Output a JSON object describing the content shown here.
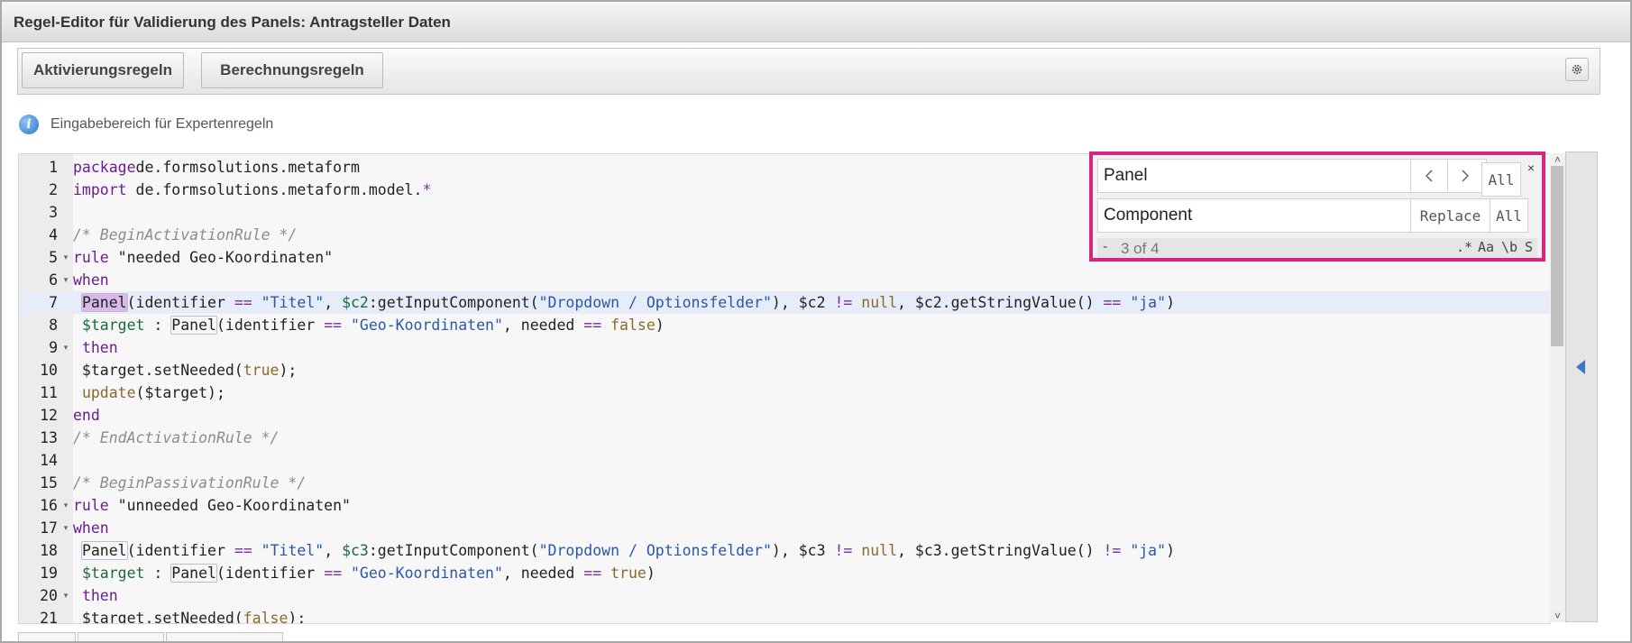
{
  "window": {
    "title": "Regel-Editor für Validierung des Panels: Antragsteller Daten"
  },
  "toolbar": {
    "activation_label": "Aktivierungsregeln",
    "calculation_label": "Berechnungsregeln",
    "settings_icon": "gear-icon"
  },
  "info": {
    "icon": "info-icon",
    "label": "Eingabebereich für Expertenregeln"
  },
  "search": {
    "find_value": "Panel",
    "replace_value": "Component",
    "prev_icon": "chevron-left-icon",
    "next_icon": "chevron-right-icon",
    "find_all_label": "All",
    "replace_label": "Replace",
    "replace_all_label": "All",
    "close_label": "×",
    "collapse_label": "-",
    "counter": "3 of 4",
    "regex_label": ".*",
    "case_label": "Aa",
    "word_label": "\\b",
    "selection_label": "S"
  },
  "editor": {
    "active_line": 7,
    "lines": [
      {
        "n": "1",
        "fold": "",
        "t": [
          [
            "kw",
            "package"
          ],
          [
            "",
            "de.formsolutions.metaform"
          ]
        ]
      },
      {
        "n": "2",
        "fold": "",
        "t": [
          [
            "kw",
            "import"
          ],
          [
            "",
            " de.formsolutions.metaform.model."
          ],
          [
            "op",
            "*"
          ]
        ]
      },
      {
        "n": "3",
        "fold": "",
        "t": []
      },
      {
        "n": "4",
        "fold": "",
        "t": [
          [
            "cm",
            "/* BeginActivationRule */"
          ]
        ]
      },
      {
        "n": "5",
        "fold": "▾",
        "t": [
          [
            "kw",
            "rule"
          ],
          [
            "",
            " \"needed Geo-Koordinaten\""
          ]
        ]
      },
      {
        "n": "6",
        "fold": "▾",
        "t": [
          [
            "kw",
            "when"
          ]
        ]
      },
      {
        "n": "7",
        "fold": "",
        "t": [
          [
            "",
            " "
          ],
          [
            "msel",
            "Panel"
          ],
          [
            "",
            "(identifier "
          ],
          [
            "op",
            "=="
          ],
          [
            "",
            " "
          ],
          [
            "st",
            "\"Titel\""
          ],
          [
            "",
            ", "
          ],
          [
            "vr",
            "$c2"
          ],
          [
            "",
            ":getInputComponent("
          ],
          [
            "st",
            "\"Dropdown / Optionsfelder\""
          ],
          [
            "",
            "), $c2 "
          ],
          [
            "op",
            "!="
          ],
          [
            "",
            " "
          ],
          [
            "lit",
            "null"
          ],
          [
            "",
            ", $c2.getStringValue() "
          ],
          [
            "op",
            "=="
          ],
          [
            "",
            " "
          ],
          [
            "st",
            "\"ja\""
          ],
          [
            "",
            ")"
          ]
        ]
      },
      {
        "n": "8",
        "fold": "",
        "t": [
          [
            "",
            " "
          ],
          [
            "vr",
            "$target"
          ],
          [
            "",
            " : "
          ],
          [
            "m",
            "Panel"
          ],
          [
            "",
            "(identifier "
          ],
          [
            "op",
            "=="
          ],
          [
            "",
            " "
          ],
          [
            "st",
            "\"Geo-Koordinaten\""
          ],
          [
            "",
            ", needed "
          ],
          [
            "op",
            "=="
          ],
          [
            "",
            " "
          ],
          [
            "lit",
            "false"
          ],
          [
            "",
            ")"
          ]
        ]
      },
      {
        "n": "9",
        "fold": "▾",
        "t": [
          [
            "",
            " "
          ],
          [
            "kw",
            "then"
          ]
        ]
      },
      {
        "n": "10",
        "fold": "",
        "t": [
          [
            "",
            ""
          ],
          [
            "",
            " $target.setNeeded("
          ],
          [
            "lit",
            "true"
          ],
          [
            "",
            ");"
          ]
        ]
      },
      {
        "n": "11",
        "fold": "",
        "t": [
          [
            "",
            " "
          ],
          [
            "lit",
            "update"
          ],
          [
            "",
            "($target);"
          ]
        ]
      },
      {
        "n": "12",
        "fold": "",
        "t": [
          [
            "kw",
            "end"
          ]
        ]
      },
      {
        "n": "13",
        "fold": "",
        "t": [
          [
            "cm",
            "/* EndActivationRule */"
          ]
        ]
      },
      {
        "n": "14",
        "fold": "",
        "t": []
      },
      {
        "n": "15",
        "fold": "",
        "t": [
          [
            "cm",
            "/* BeginPassivationRule */"
          ]
        ]
      },
      {
        "n": "16",
        "fold": "▾",
        "t": [
          [
            "kw",
            "rule"
          ],
          [
            "",
            " \"unneeded Geo-Koordinaten\""
          ]
        ]
      },
      {
        "n": "17",
        "fold": "▾",
        "t": [
          [
            "kw",
            "when"
          ]
        ]
      },
      {
        "n": "18",
        "fold": "",
        "t": [
          [
            "",
            " "
          ],
          [
            "m",
            "Panel"
          ],
          [
            "",
            "(identifier "
          ],
          [
            "op",
            "=="
          ],
          [
            "",
            " "
          ],
          [
            "st",
            "\"Titel\""
          ],
          [
            "",
            ", "
          ],
          [
            "vr",
            "$c3"
          ],
          [
            "",
            ":getInputComponent("
          ],
          [
            "st",
            "\"Dropdown / Optionsfelder\""
          ],
          [
            "",
            "), $c3 "
          ],
          [
            "op",
            "!="
          ],
          [
            "",
            " "
          ],
          [
            "lit",
            "null"
          ],
          [
            "",
            ", $c3.getStringValue() "
          ],
          [
            "op",
            "!="
          ],
          [
            "",
            " "
          ],
          [
            "st",
            "\"ja\""
          ],
          [
            "",
            ")"
          ]
        ]
      },
      {
        "n": "19",
        "fold": "",
        "t": [
          [
            "",
            " "
          ],
          [
            "vr",
            "$target"
          ],
          [
            "",
            " : "
          ],
          [
            "m",
            "Panel"
          ],
          [
            "",
            "(identifier "
          ],
          [
            "op",
            "=="
          ],
          [
            "",
            " "
          ],
          [
            "st",
            "\"Geo-Koordinaten\""
          ],
          [
            "",
            ", needed "
          ],
          [
            "op",
            "=="
          ],
          [
            "",
            " "
          ],
          [
            "lit",
            "true"
          ],
          [
            "",
            ")"
          ]
        ]
      },
      {
        "n": "20",
        "fold": "▾",
        "t": [
          [
            "",
            " "
          ],
          [
            "kw",
            "then"
          ]
        ]
      },
      {
        "n": "21",
        "fold": "",
        "t": [
          [
            "",
            ""
          ],
          [
            "",
            " $target.setNeeded("
          ],
          [
            "lit",
            "false"
          ],
          [
            "",
            ");"
          ]
        ]
      }
    ]
  }
}
